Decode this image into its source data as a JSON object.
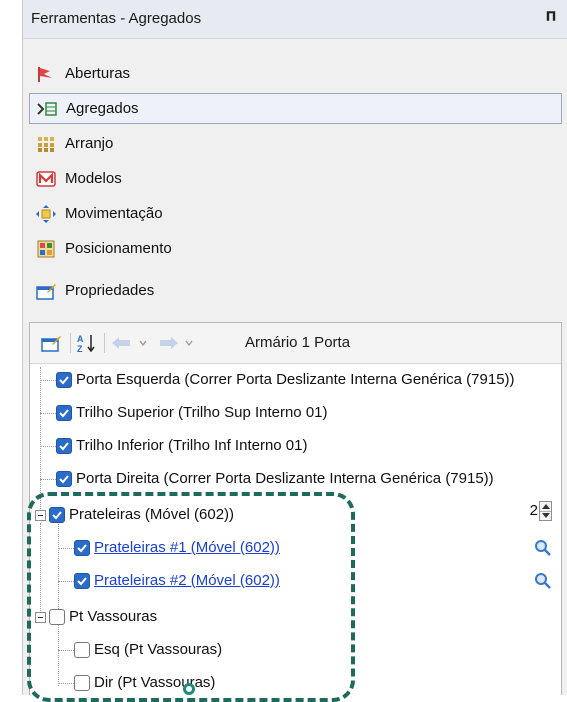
{
  "panel": {
    "title": "Ferramentas - Agregados",
    "pin_icon": "pin-icon"
  },
  "menu": {
    "items": [
      {
        "label": "Aberturas",
        "icon": "flag-icon"
      },
      {
        "label": "Agregados",
        "icon": "aggregates-icon",
        "selected": true
      },
      {
        "label": "Arranjo",
        "icon": "grid-icon"
      },
      {
        "label": "Modelos",
        "icon": "models-icon"
      },
      {
        "label": "Movimentação",
        "icon": "move-icon"
      },
      {
        "label": "Posicionamento",
        "icon": "position-icon"
      },
      {
        "label": "Propriedades",
        "icon": "properties-icon"
      }
    ]
  },
  "toolbar": {
    "breadcrumb": "Armário 1 Porta",
    "icons": [
      "properties-icon",
      "sort-az-icon",
      "back-arrow-icon",
      "forward-arrow-icon"
    ]
  },
  "tree": {
    "nodes": [
      {
        "label": "Porta Esquerda (Correr Porta Deslizante Interna Genérica  (7915))",
        "checked": true
      },
      {
        "label": "Trilho Superior (Trilho Sup Interno 01)",
        "checked": true
      },
      {
        "label": "Trilho Inferior (Trilho Inf Interno 01)",
        "checked": true
      },
      {
        "label": "Porta Direita (Correr Porta Deslizante Interna Genérica  (7915))",
        "checked": true
      },
      {
        "label": "Prateleiras (Móvel (602))",
        "checked": true,
        "stepper_value": "2"
      },
      {
        "label": "Prateleiras #1 (Móvel (602))",
        "checked": true,
        "link": true
      },
      {
        "label": "Prateleiras #2 (Móvel (602))",
        "checked": true,
        "link": true
      },
      {
        "label": "Pt Vassouras",
        "checked": false
      },
      {
        "label": "Esq (Pt Vassouras)",
        "checked": false
      },
      {
        "label": "Dir (Pt Vassouras)",
        "checked": false
      }
    ]
  },
  "colors": {
    "accent": "#2a6cc8",
    "link": "#1a3fd4",
    "highlight": "#1f6a5d"
  }
}
